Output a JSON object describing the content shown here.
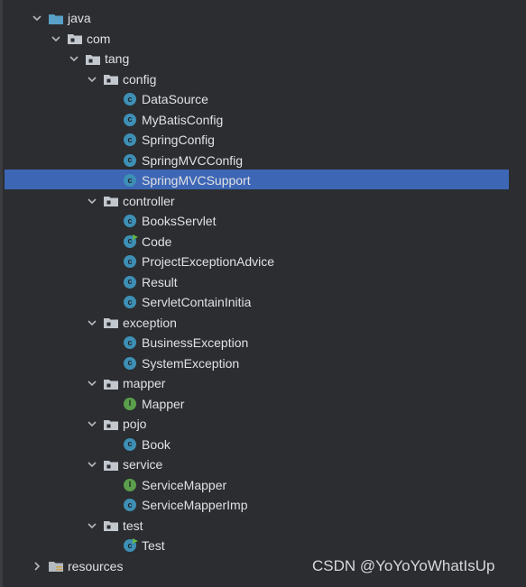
{
  "tree": [
    {
      "label": "java",
      "kind": "source-folder",
      "expanded": true,
      "level": 0,
      "icon": "source-root-folder-icon"
    },
    {
      "label": "com",
      "kind": "package",
      "expanded": true,
      "level": 1,
      "icon": "package-folder-icon"
    },
    {
      "label": "tang",
      "kind": "package",
      "expanded": true,
      "level": 2,
      "icon": "package-folder-icon"
    },
    {
      "label": "config",
      "kind": "package",
      "expanded": true,
      "level": 3,
      "icon": "package-folder-icon"
    },
    {
      "label": "DataSource",
      "kind": "class",
      "level": 4,
      "icon": "class-icon"
    },
    {
      "label": "MyBatisConfig",
      "kind": "class",
      "level": 4,
      "icon": "class-icon"
    },
    {
      "label": "SpringConfig",
      "kind": "class",
      "level": 4,
      "icon": "class-icon"
    },
    {
      "label": "SpringMVCConfig",
      "kind": "class",
      "level": 4,
      "icon": "class-icon"
    },
    {
      "label": "SpringMVCSupport",
      "kind": "class",
      "level": 4,
      "icon": "class-icon",
      "selected": true
    },
    {
      "label": "controller",
      "kind": "package",
      "expanded": true,
      "level": 3,
      "icon": "package-folder-icon"
    },
    {
      "label": "BooksServlet",
      "kind": "class",
      "level": 4,
      "icon": "class-icon"
    },
    {
      "label": "Code",
      "kind": "runnable-class",
      "level": 4,
      "icon": "runnable-class-icon"
    },
    {
      "label": "ProjectExceptionAdvice",
      "kind": "class",
      "level": 4,
      "icon": "class-icon"
    },
    {
      "label": "Result",
      "kind": "class",
      "level": 4,
      "icon": "class-icon"
    },
    {
      "label": "ServletContainInitia",
      "kind": "class",
      "level": 4,
      "icon": "class-icon"
    },
    {
      "label": "exception",
      "kind": "package",
      "expanded": true,
      "level": 3,
      "icon": "package-folder-icon"
    },
    {
      "label": "BusinessException",
      "kind": "class",
      "level": 4,
      "icon": "class-icon"
    },
    {
      "label": "SystemException",
      "kind": "class",
      "level": 4,
      "icon": "class-icon"
    },
    {
      "label": "mapper",
      "kind": "package",
      "expanded": true,
      "level": 3,
      "icon": "package-folder-icon"
    },
    {
      "label": "Mapper",
      "kind": "interface",
      "level": 4,
      "icon": "interface-icon"
    },
    {
      "label": "pojo",
      "kind": "package",
      "expanded": true,
      "level": 3,
      "icon": "package-folder-icon"
    },
    {
      "label": "Book",
      "kind": "class",
      "level": 4,
      "icon": "class-icon"
    },
    {
      "label": "service",
      "kind": "package",
      "expanded": true,
      "level": 3,
      "icon": "package-folder-icon"
    },
    {
      "label": "ServiceMapper",
      "kind": "interface",
      "level": 4,
      "icon": "interface-icon"
    },
    {
      "label": "ServiceMapperImp",
      "kind": "class",
      "level": 4,
      "icon": "class-icon"
    },
    {
      "label": "test",
      "kind": "package",
      "expanded": true,
      "level": 3,
      "icon": "package-folder-icon"
    },
    {
      "label": "Test",
      "kind": "runnable-class",
      "level": 4,
      "icon": "runnable-class-icon"
    },
    {
      "label": "resources",
      "kind": "resource-folder",
      "expanded": false,
      "level": 0,
      "icon": "resources-root-folder-icon"
    }
  ],
  "watermark": "CSDN @YoYoYoWhatIsUp",
  "colors": {
    "background": "#2b2d30",
    "selection": "#3d66b5",
    "text": "#dfe1e5",
    "class_icon": "#3d8fb5",
    "interface_icon": "#5a9f4b",
    "source_folder": "#5aa1c9",
    "run_marker": "#62b543"
  }
}
